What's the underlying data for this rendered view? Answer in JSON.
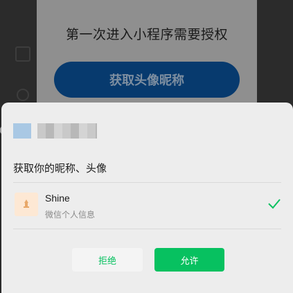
{
  "background": {
    "title": "第一次进入小程序需要授权",
    "button_label": "获取头像昵称"
  },
  "sheet": {
    "request_title": "获取你的昵称、头像",
    "profile": {
      "name": "Shine",
      "subtitle": "微信个人信息",
      "selected": true
    },
    "buttons": {
      "reject_label": "拒绝",
      "allow_label": "允许"
    }
  },
  "colors": {
    "accent": "#07c160",
    "sheet_bg": "#ededed",
    "overlay_bg": "#2b2b2b"
  }
}
